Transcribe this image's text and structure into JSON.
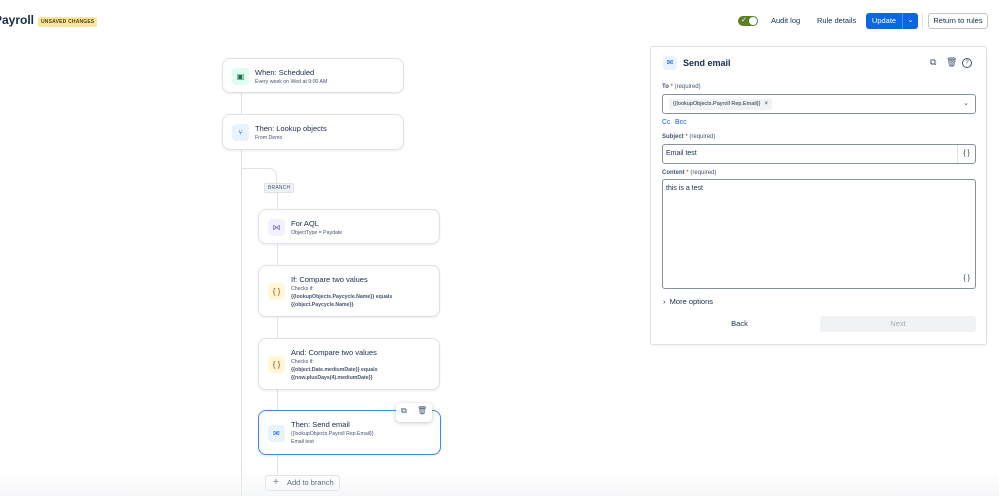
{
  "header": {
    "title": "Payroll",
    "badge": "UNSAVED CHANGES",
    "check_glyph": "✓",
    "audit_log": "Audit log",
    "rule_details": "Rule details",
    "update": "Update",
    "update_dropdown_glyph": "⌄",
    "return": "Return to rules"
  },
  "flow": {
    "trigger": {
      "title": "When: Scheduled",
      "subtitle": "Every week on Wed at 9:00 AM",
      "icon": "calendar-icon",
      "glyph": "▣"
    },
    "lookup": {
      "title": "Then: Lookup objects",
      "subtitle": "From Demo",
      "icon": "branch-icon",
      "glyph": "⑂"
    },
    "branch_label": "BRANCH",
    "for_aql": {
      "title": "For AQL",
      "subtitle": "ObjectType = Paydate",
      "icon": "aql-icon",
      "glyph": "⋈"
    },
    "if_compare": {
      "title": "If: Compare two values",
      "checks": "Checks if:",
      "line1": "{{lookupObjects.Paycycle.Name}} equals",
      "line2": "{{object.Paycycle.Name}}",
      "icon": "braces-icon",
      "glyph": "{ }"
    },
    "and_compare": {
      "title": "And: Compare two values",
      "checks": "Checks if:",
      "line1": "{{object.Date.mediumDate}} equals",
      "line2": "{{now.plusDays(4).mediumDate}}",
      "icon": "braces-icon",
      "glyph": "{ }"
    },
    "send_email": {
      "title": "Then: Send email",
      "line1": "{{lookupObjects.Payroll Rep.Email}}",
      "line2": "Email test",
      "icon": "mail-icon",
      "glyph": "✉"
    },
    "tool_copy_glyph": "⧉",
    "tool_delete_glyph": "🗑",
    "add_to_branch": "Add to branch",
    "add_glyph": "+"
  },
  "panel": {
    "title": "Send email",
    "icon_glyph": "✉",
    "tool_copy_glyph": "⧉",
    "tool_delete_glyph": "🗑",
    "tool_help_glyph": "?",
    "to_label": "To",
    "required_mark": "*",
    "required_text": "(required)",
    "to_chip": "{{lookupObjects.Payroll Rep.Email}}",
    "chip_remove_glyph": "×",
    "to_dropdown_glyph": "⌄",
    "cc": "Cc",
    "bcc": "Bcc",
    "subject_label": "Subject",
    "subject_value": "Email test",
    "content_label": "Content",
    "content_value": "this is a test",
    "brace_glyph": "{ }",
    "more_glyph": "›",
    "more_options": "More options",
    "back": "Back",
    "next": "Next"
  }
}
